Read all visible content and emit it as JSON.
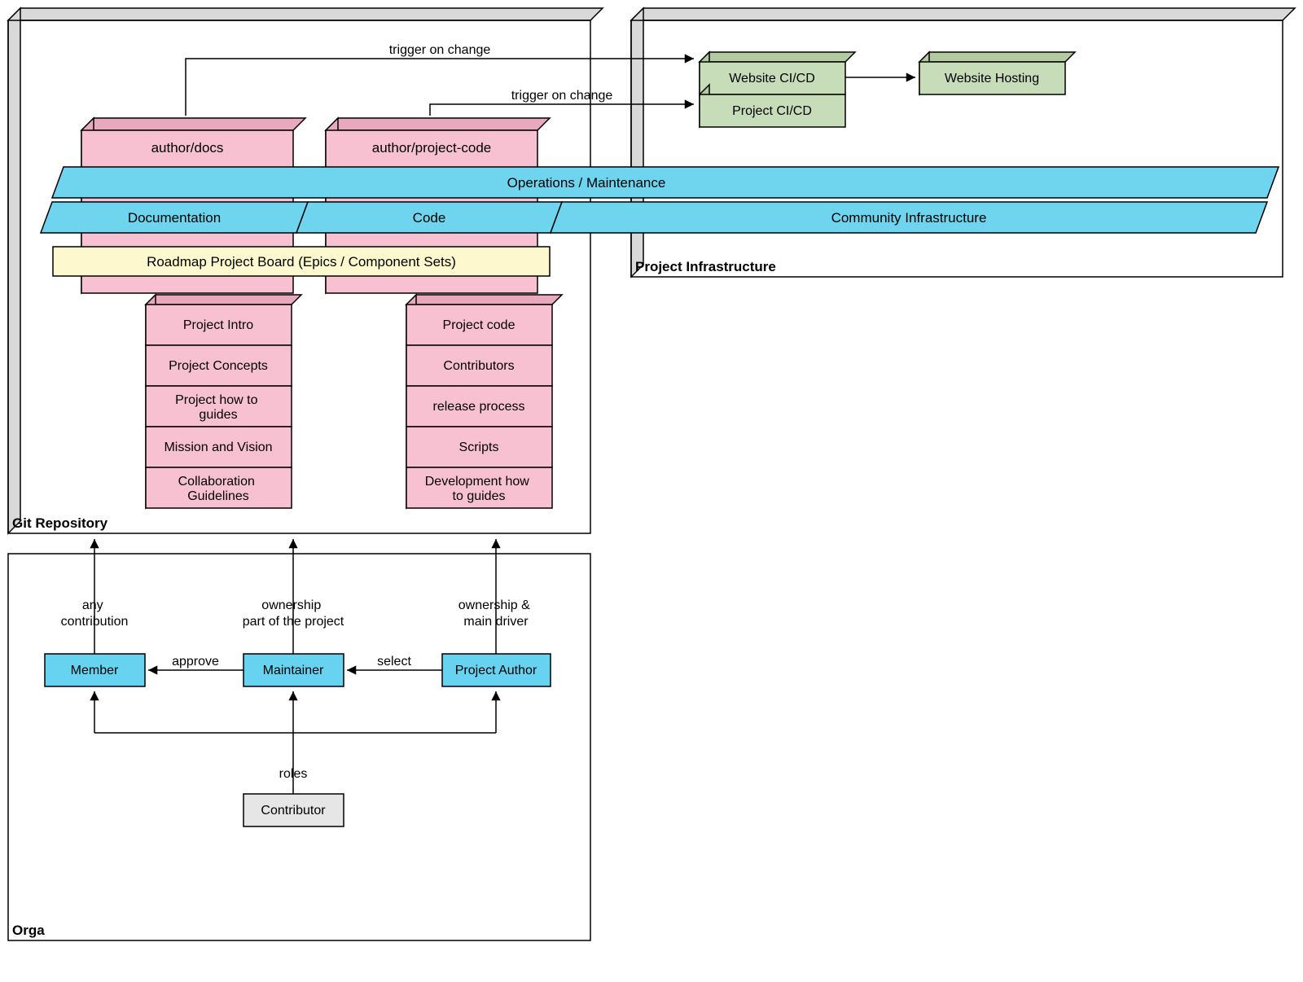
{
  "frames": {
    "git_repo": "Git Repository",
    "project_infra": "Project Infrastructure",
    "orga": "Orga"
  },
  "pink_blocks": {
    "docs_repo": "author/docs",
    "code_repo": "author/project-code",
    "docs_items": [
      "Project Intro",
      "Project Concepts",
      "Project how to guides",
      "Mission and Vision",
      "Collaboration Guidelines"
    ],
    "code_items": [
      "Project code",
      "Contributors",
      "release process",
      "Scripts",
      "Development how to guides"
    ]
  },
  "bands": {
    "ops": "Operations / Maintenance",
    "docs": "Documentation",
    "code": "Code",
    "community": "Community Infrastructure",
    "roadmap": "Roadmap Project Board (Epics / Component Sets)"
  },
  "infra_boxes": {
    "website_cicd": "Website CI/CD",
    "project_cicd": "Project CI/CD",
    "website_hosting": "Website Hosting"
  },
  "arrows": {
    "trigger1": "trigger on change",
    "trigger2": "trigger on change"
  },
  "orga": {
    "member": "Member",
    "maintainer": "Maintainer",
    "project_author": "Project Author",
    "contributor": "Contributor",
    "approve": "approve",
    "select": "select",
    "roles": "roles",
    "any_contribution_l1": "any",
    "any_contribution_l2": "contribution",
    "ownership_part_l1": "ownership",
    "ownership_part_l2": "part of the project",
    "ownership_main_l1": "ownership &",
    "ownership_main_l2": "main driver"
  },
  "colors": {
    "pink_fill": "#f7c1d2",
    "pink_side": "#e8a8bd",
    "cyan": "#6fd4ee",
    "cream": "#fdf8ce",
    "green_fill": "#c7dcb8",
    "green_side": "#b4cba1",
    "blue_box": "#68d3f0",
    "grey_box": "#e6e6e6",
    "frame_grey": "#d9d9d9"
  }
}
